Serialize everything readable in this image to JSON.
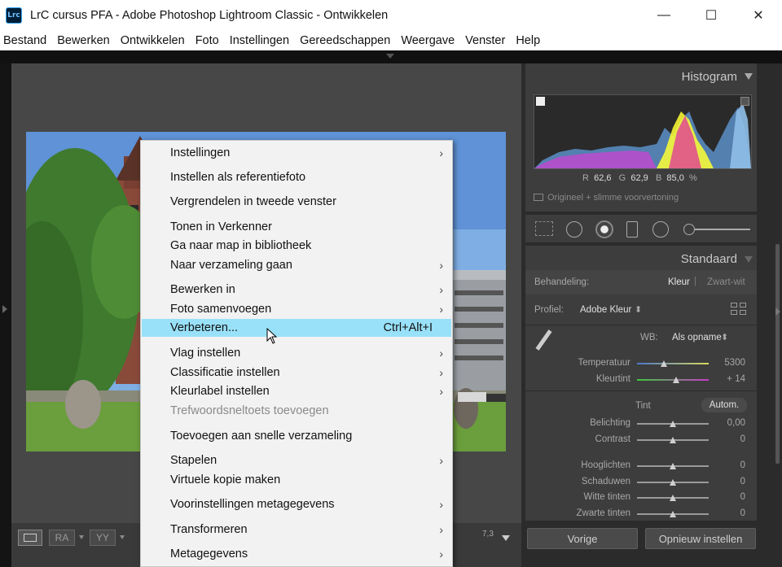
{
  "window": {
    "app_icon": "Lrc",
    "title": "LrC cursus PFA - Adobe Photoshop Lightroom Classic - Ontwikkelen",
    "minimize": "—",
    "maximize": "☐",
    "close": "✕"
  },
  "menubar": [
    "Bestand",
    "Bewerken",
    "Ontwikkelen",
    "Foto",
    "Instellingen",
    "Gereedschappen",
    "Weergave",
    "Venster",
    "Help"
  ],
  "context_menu": {
    "items": [
      {
        "label": "Instellingen",
        "submenu": true
      },
      {
        "label": "Instellen als referentiefoto"
      },
      {
        "label": "Vergrendelen in tweede venster"
      },
      {
        "label": "Tonen in Verkenner"
      },
      {
        "label": "Ga naar map in bibliotheek"
      },
      {
        "label": "Naar verzameling gaan",
        "submenu": true
      },
      {
        "label": "Bewerken in",
        "submenu": true
      },
      {
        "label": "Foto samenvoegen",
        "submenu": true
      },
      {
        "label": "Verbeteren...",
        "shortcut": "Ctrl+Alt+I",
        "highlighted": true
      },
      {
        "label": "Vlag instellen",
        "submenu": true
      },
      {
        "label": "Classificatie instellen",
        "submenu": true
      },
      {
        "label": "Kleurlabel instellen",
        "submenu": true
      },
      {
        "label": "Trefwoordsneltoets toevoegen",
        "disabled": true
      },
      {
        "label": "Toevoegen aan snelle verzameling"
      },
      {
        "label": "Stapelen",
        "submenu": true
      },
      {
        "label": "Virtuele kopie maken"
      },
      {
        "label": "Voorinstellingen metagegevens",
        "submenu": true
      },
      {
        "label": "Transformeren",
        "submenu": true
      },
      {
        "label": "Metagegevens",
        "submenu": true
      }
    ],
    "submenu_arrow": "›"
  },
  "histogram": {
    "title": "Histogram",
    "r_label": "R",
    "r_value": "62,6",
    "g_label": "G",
    "g_value": "62,9",
    "b_label": "B",
    "b_value": "85,0",
    "unit": "%",
    "preview_label": "Origineel + slimme voorvertoning"
  },
  "basic": {
    "title": "Standaard",
    "treatment_label": "Behandeling:",
    "treatment_color": "Kleur",
    "treatment_bw": "Zwart-wit",
    "profile_label": "Profiel:",
    "profile_value": "Adobe Kleur",
    "wb_label": "WB:",
    "wb_value": "Als opname",
    "sliders_wb": [
      {
        "label": "Temperatuur",
        "value": "5300",
        "pos": 0.38
      },
      {
        "label": "Kleurtint",
        "value": "+ 14",
        "pos": 0.55
      }
    ],
    "tint_label": "Tint",
    "auto_label": "Autom.",
    "sliders_tone": [
      {
        "label": "Belichting",
        "value": "0,00",
        "pos": 0.5
      },
      {
        "label": "Contrast",
        "value": "0",
        "pos": 0.5
      }
    ],
    "sliders_presence": [
      {
        "label": "Hooglichten",
        "value": "0",
        "pos": 0.5
      },
      {
        "label": "Schaduwen",
        "value": "0",
        "pos": 0.5
      },
      {
        "label": "Witte tinten",
        "value": "0",
        "pos": 0.5
      },
      {
        "label": "Zwarte tinten",
        "value": "0",
        "pos": 0.5
      }
    ]
  },
  "buttons": {
    "previous": "Vorige",
    "reset": "Opnieuw instellen"
  },
  "toolbar": {
    "zoom_value": "7,3",
    "ra_label": "RA",
    "yy_label": "YY"
  },
  "colors": {
    "highlight": "#99e1f9",
    "panel": "#3d3d3d"
  }
}
